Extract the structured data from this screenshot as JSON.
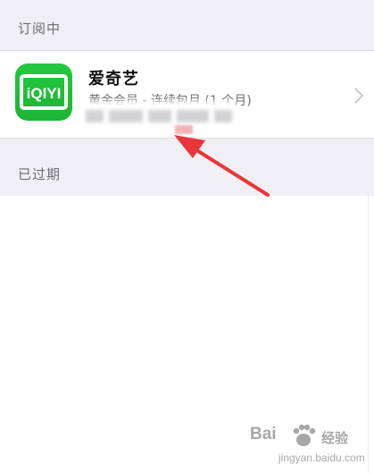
{
  "sections": {
    "subscribed_header": "订阅中",
    "expired_header": "已过期"
  },
  "subscription": {
    "app_icon_text": "iQIYI",
    "app_name": "爱奇艺",
    "plan": "黄金会员 - 连续包月 (1 个月)",
    "icon_name": "iqiyi-app-icon"
  },
  "watermark": {
    "brand_left": "Bai",
    "brand_right": "经验",
    "url": "jingyan.baidu.com"
  },
  "colors": {
    "background": "#efeff4",
    "icon_green": "#20c03a",
    "arrow_red": "#e8373a",
    "secondary_text": "#6d6d72"
  }
}
